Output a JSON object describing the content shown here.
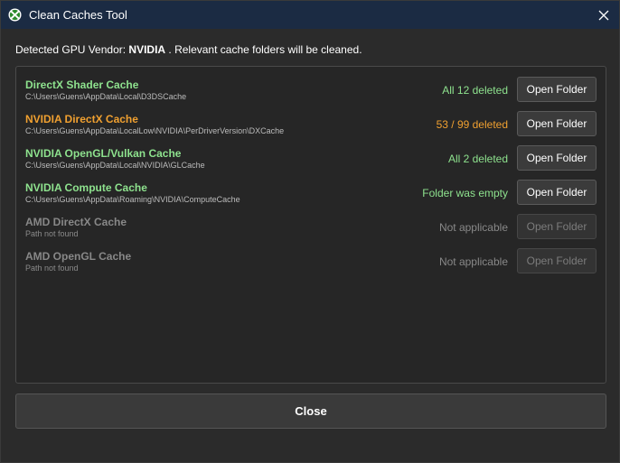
{
  "window": {
    "title": "Clean Caches Tool",
    "icon": "xbox-logo-icon",
    "close_icon": "close-icon"
  },
  "detection": {
    "prefix": "Detected GPU Vendor: ",
    "vendor": "NVIDIA",
    "suffix": " . Relevant cache folders will be cleaned."
  },
  "caches": [
    {
      "name": "DirectX Shader Cache",
      "path": "C:\\Users\\Guens\\AppData\\Local\\D3DSCache",
      "status": "All 12 deleted",
      "button": "Open Folder",
      "state": "success"
    },
    {
      "name": "NVIDIA DirectX Cache",
      "path": "C:\\Users\\Guens\\AppData\\LocalLow\\NVIDIA\\PerDriverVersion\\DXCache",
      "status": "53 / 99 deleted",
      "button": "Open Folder",
      "state": "partial"
    },
    {
      "name": "NVIDIA OpenGL/Vulkan Cache",
      "path": "C:\\Users\\Guens\\AppData\\Local\\NVIDIA\\GLCache",
      "status": "All 2 deleted",
      "button": "Open Folder",
      "state": "success"
    },
    {
      "name": "NVIDIA Compute Cache",
      "path": "C:\\Users\\Guens\\AppData\\Roaming\\NVIDIA\\ComputeCache",
      "status": "Folder was empty",
      "button": "Open Folder",
      "state": "success"
    },
    {
      "name": "AMD DirectX Cache",
      "path": "Path not found",
      "status": "Not applicable",
      "button": "Open Folder",
      "state": "disabled"
    },
    {
      "name": "AMD OpenGL Cache",
      "path": "Path not found",
      "status": "Not applicable",
      "button": "Open Folder",
      "state": "disabled"
    }
  ],
  "footer": {
    "close_label": "Close"
  },
  "colors": {
    "titlebar": "#1b2b43",
    "success": "#8ee28e",
    "partial": "#f0a030",
    "disabled": "#888888"
  }
}
